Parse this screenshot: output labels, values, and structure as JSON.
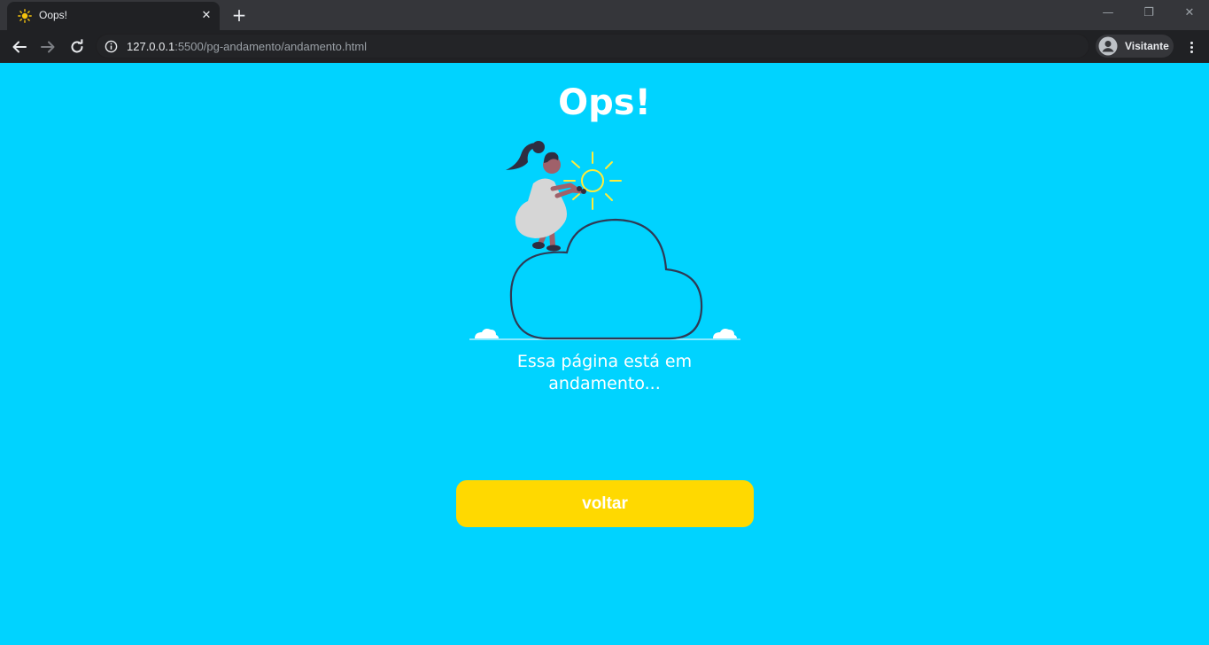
{
  "browser": {
    "tab_title": "Oops!",
    "tab_close_glyph": "✕",
    "new_tab_glyph": "+",
    "url_host": "127.0.0.1",
    "url_rest": ":5500/pg-andamento/andamento.html",
    "profile_label": "Visitante",
    "window_controls": {
      "minimize": "—",
      "restore": "❐",
      "close": "✕"
    },
    "icons": [
      "sun-favicon-icon",
      "back-arrow-icon",
      "forward-arrow-icon",
      "reload-icon",
      "info-icon",
      "avatar-icon",
      "kebab-menu-icon"
    ]
  },
  "page": {
    "title": "Ops!",
    "message": "Essa página está em andamento...",
    "button_label": "voltar"
  },
  "colors": {
    "background": "#00d3ff",
    "button": "#ffd900",
    "sun": "#ffeb3b",
    "cloud_stroke": "#2f3a55"
  }
}
